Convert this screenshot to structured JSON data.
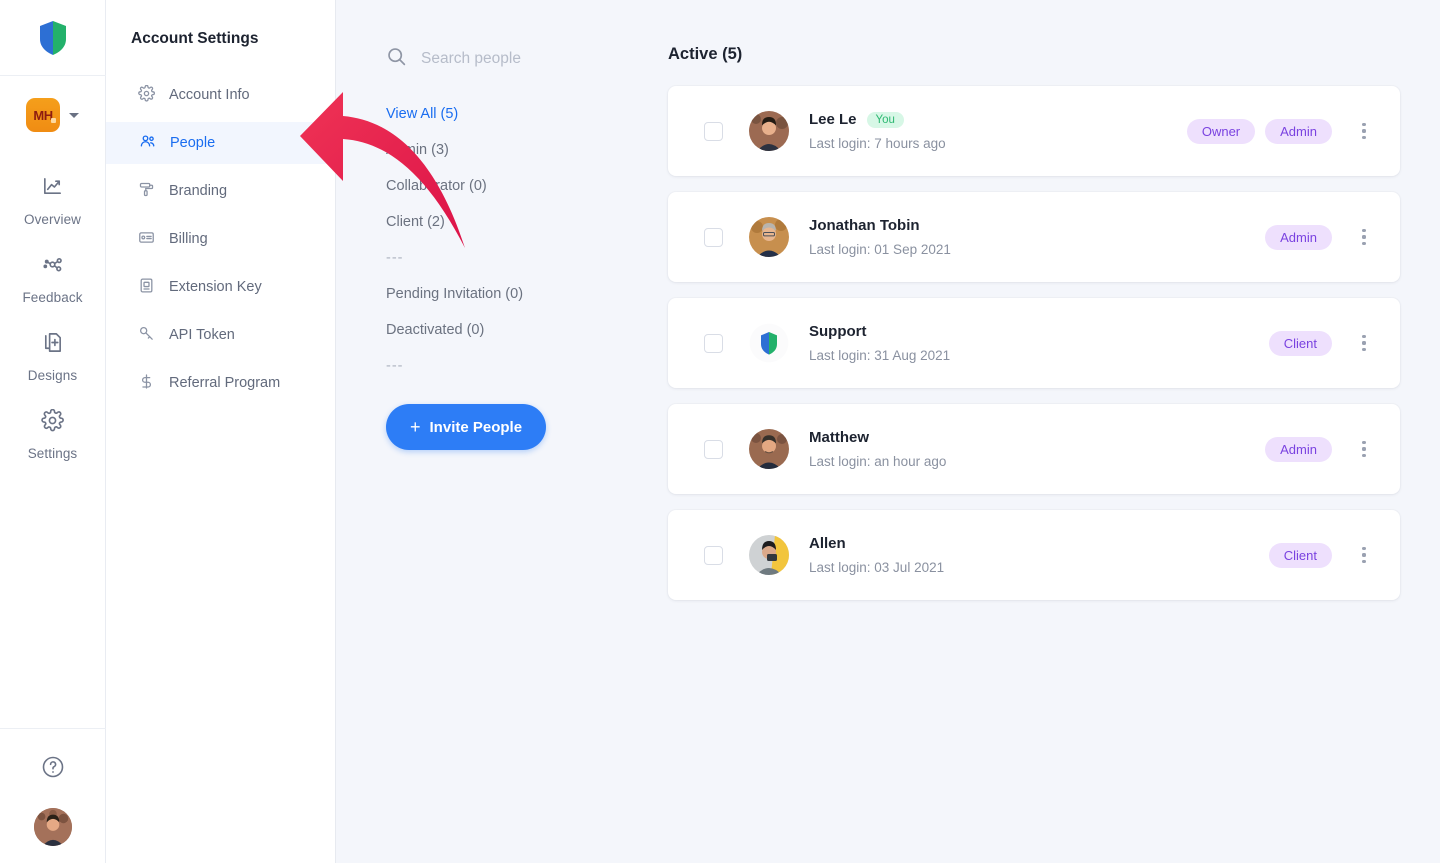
{
  "brand": {
    "logo_icon": "shield-logo"
  },
  "rail": {
    "workspace": {
      "initials": "MH",
      "caret_icon": "chevron-down-icon"
    },
    "items": [
      {
        "label": "Overview",
        "icon": "chart-trend-icon"
      },
      {
        "label": "Feedback",
        "icon": "share-nodes-icon"
      },
      {
        "label": "Designs",
        "icon": "document-plus-icon"
      },
      {
        "label": "Settings",
        "icon": "gear-icon"
      }
    ],
    "help_icon": "help-circle-icon",
    "avatar_icon": "user-avatar"
  },
  "settings": {
    "title": "Account Settings",
    "items": [
      {
        "label": "Account Info",
        "icon": "gear-icon",
        "active": false
      },
      {
        "label": "People",
        "icon": "people-icon",
        "active": true
      },
      {
        "label": "Branding",
        "icon": "paint-roller-icon",
        "active": false
      },
      {
        "label": "Billing",
        "icon": "card-icon",
        "active": false
      },
      {
        "label": "Extension Key",
        "icon": "key-card-icon",
        "active": false
      },
      {
        "label": "API Token",
        "icon": "key-icon",
        "active": false
      },
      {
        "label": "Referral Program",
        "icon": "dollar-icon",
        "active": false
      }
    ]
  },
  "search": {
    "placeholder": "Search people",
    "value": "",
    "icon": "search-icon"
  },
  "filters": [
    {
      "label": "View All (5)",
      "active": true,
      "type": "link"
    },
    {
      "label": "Admin (3)",
      "active": false,
      "type": "link"
    },
    {
      "label": "Collaborator (0)",
      "active": false,
      "type": "link"
    },
    {
      "label": "Client (2)",
      "active": false,
      "type": "link"
    },
    {
      "label": "---",
      "active": false,
      "type": "separator"
    },
    {
      "label": "Pending Invitation (0)",
      "active": false,
      "type": "link"
    },
    {
      "label": "Deactivated (0)",
      "active": false,
      "type": "link"
    },
    {
      "label": "---",
      "active": false,
      "type": "separator"
    }
  ],
  "invite_button": {
    "label": "Invite People",
    "plus": "+"
  },
  "main": {
    "title": "Active (5)",
    "people": [
      {
        "name": "Lee Le",
        "you_badge": "You",
        "last_login": "Last login: 7 hours ago",
        "roles": [
          "Owner",
          "Admin"
        ],
        "avatar_type": "photo-lee"
      },
      {
        "name": "Jonathan Tobin",
        "you_badge": "",
        "last_login": "Last login: 01 Sep 2021",
        "roles": [
          "Admin"
        ],
        "avatar_type": "photo-jonathan"
      },
      {
        "name": "Support",
        "you_badge": "",
        "last_login": "Last login: 31 Aug 2021",
        "roles": [
          "Client"
        ],
        "avatar_type": "shield-logo"
      },
      {
        "name": "Matthew",
        "you_badge": "",
        "last_login": "Last login: an hour ago",
        "roles": [
          "Admin"
        ],
        "avatar_type": "photo-matthew"
      },
      {
        "name": "Allen",
        "you_badge": "",
        "last_login": "Last login: 03 Jul 2021",
        "roles": [
          "Client"
        ],
        "avatar_type": "photo-allen"
      }
    ]
  },
  "annotation": {
    "type": "red-arrow",
    "points_to": "People",
    "color": "#e8244f"
  },
  "colors": {
    "accent_blue": "#1a6df0",
    "button_blue": "#2d7df6",
    "role_badge_bg": "#eee0fd",
    "role_badge_text": "#7a42e0",
    "you_badge_bg": "#d7f7e6",
    "you_badge_text": "#2eb872",
    "page_bg": "#f4f6fb",
    "brand_orange": "#f08c13"
  }
}
